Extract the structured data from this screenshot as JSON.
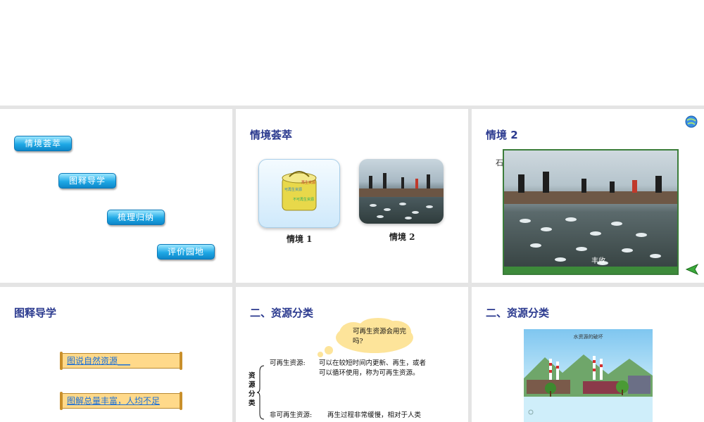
{
  "slide1": {
    "nav": [
      "情境荟萃",
      "图释导学",
      "梳理归纳",
      "评价园地"
    ]
  },
  "slide2": {
    "title": "情境荟萃",
    "thumbs": [
      "情境 1",
      "情境 2"
    ],
    "can_text": [
      "再生资源",
      "可再生资源",
      "不可再生资源"
    ]
  },
  "slide3": {
    "title": "情境 2",
    "edge_text": "石",
    "caption": "丰收"
  },
  "slide4": {
    "title": "图释导学",
    "scrolls": [
      "图说自然资源___",
      "图解总量丰富，人均不足"
    ]
  },
  "slide5": {
    "title": "二、资源分类",
    "cloud_text": "可再生资源会用完吗?",
    "category": "资源分类",
    "renewable_label": "可再生资源:",
    "renewable_desc": "可以在较短时间内更新、再生，或者可以循环使用，称为可再生资源。",
    "nonrenewable_label": "非可再生资源:",
    "nonrenewable_desc": "再生过程非常缓慢，相对于人类"
  },
  "slide6": {
    "title": "二、资源分类",
    "image_title": "水资源的破坏"
  },
  "colors": {
    "title": "#2b3a8f",
    "nav": "#1fa9e6",
    "scroll_text": "#1b6fd6"
  }
}
